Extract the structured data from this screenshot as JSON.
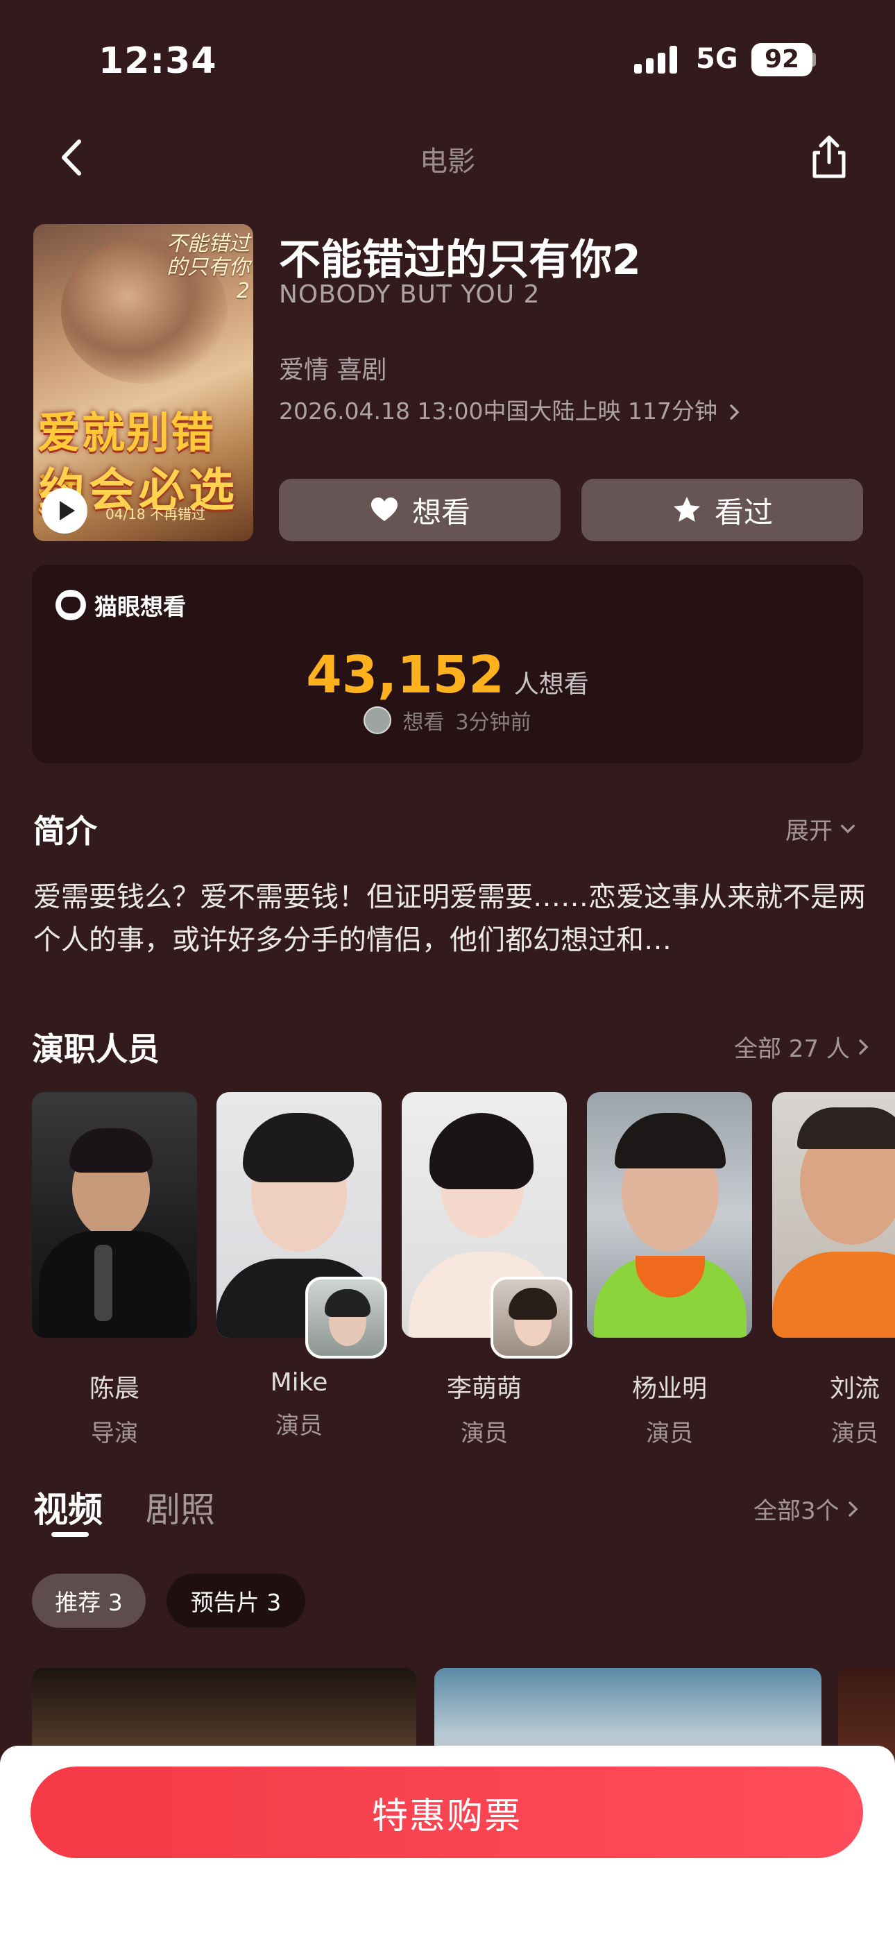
{
  "status_bar": {
    "time": "12:34",
    "network": "5G",
    "battery": "92"
  },
  "nav": {
    "title": "电影",
    "back_icon": "chevron-left-icon",
    "share_icon": "share-icon"
  },
  "movie": {
    "title": "不能错过的只有你2",
    "english_title": "NOBODY BUT YOU 2",
    "genres": "爱情 喜剧",
    "release_info": "2026.04.18 13:00中国大陆上映 117分钟",
    "poster": {
      "tagline_1": "爱就别错过",
      "tagline_2": "约会必选",
      "date": "04/18 不再错过",
      "logo": "不能错过的只有你2"
    }
  },
  "actions": {
    "want_label": "想看",
    "watched_label": "看过"
  },
  "want_card": {
    "label": "猫眼想看",
    "count": "43,152",
    "unit": "人想看",
    "recent_action": "想看",
    "recent_time": "3分钟前"
  },
  "synopsis": {
    "title": "简介",
    "expand_label": "展开",
    "text": "爱需要钱么？爱不需要钱！但证明爱需要……恋爱这事从来就不是两个人的事，或许好多分手的情侣，他们都幻想过和…"
  },
  "cast": {
    "title": "演职人员",
    "more_label": "全部 27 人",
    "members": [
      {
        "name": "陈晨",
        "role": "导演"
      },
      {
        "name": "Mike",
        "role": "演员"
      },
      {
        "name": "李萌萌",
        "role": "演员"
      },
      {
        "name": "杨业明",
        "role": "演员"
      },
      {
        "name": "刘流",
        "role": "演员"
      }
    ]
  },
  "media": {
    "tabs": [
      "视频",
      "剧照"
    ],
    "active_tab": "视频",
    "more_label": "全部3个",
    "chips": [
      "推荐 3",
      "预告片 3"
    ]
  },
  "buy_button": {
    "label": "特惠购票"
  },
  "colors": {
    "background": "#331a1c",
    "accent": "#ffb21e",
    "buy": "#f33a46"
  }
}
